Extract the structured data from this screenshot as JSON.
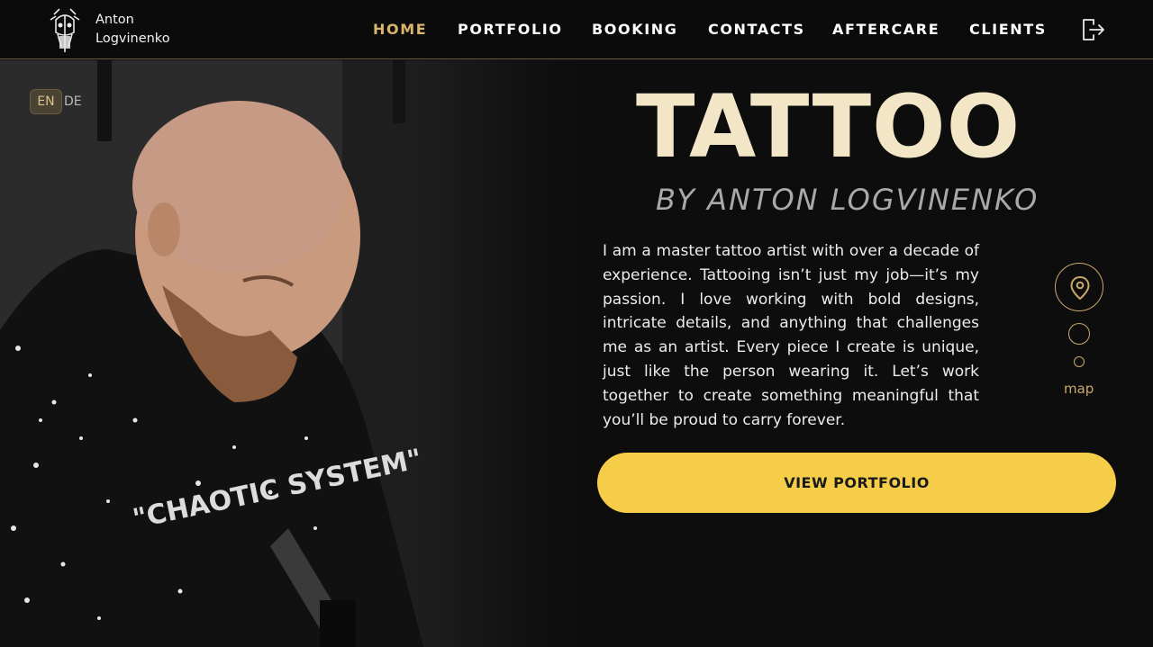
{
  "header": {
    "brand_first": "Anton",
    "brand_last": "Logvinenko",
    "logo_icon": "viking-skull-logo-icon",
    "nav": [
      {
        "label": "HOME",
        "active": true
      },
      {
        "label": "PORTFOLIO",
        "active": false
      },
      {
        "label": "BOOKING",
        "active": false
      },
      {
        "label": "CONTACTS",
        "active": false
      },
      {
        "label": "AFTERCARE",
        "active": false
      },
      {
        "label": "CLIENTS",
        "active": false
      }
    ],
    "logout_icon": "logout-icon"
  },
  "language": {
    "active": "EN",
    "other": "DE"
  },
  "hero": {
    "title": "TATTOO",
    "subtitle": "BY ANTON LOGVINENKO",
    "description": "I am a master tattoo artist with over a decade of experience. Tattooing isn’t just my job—it’s my passion. I love working with bold designs, intricate details, and anything that challenges me as an artist. Every piece I create is unique, just like the person wearing it. Let’s work together to create something meaningful that you’ll be proud to carry forever.",
    "cta_label": "VIEW PORTFOLIO",
    "map_label": "map",
    "shirt_text": "\"CHAOTIC SYSTEM\""
  },
  "colors": {
    "accent_gold": "#d9b56e",
    "cta_yellow": "#f5cd48",
    "title_cream": "#f3e6c6",
    "background": "#0d0d0d"
  }
}
